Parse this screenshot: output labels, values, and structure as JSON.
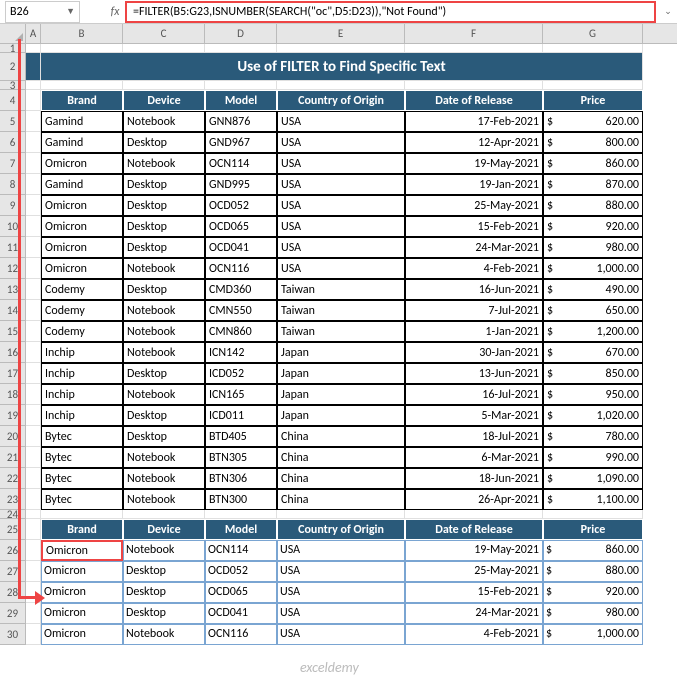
{
  "nameBox": "B26",
  "formula": "=FILTER(B5:G23,ISNUMBER(SEARCH(\"oc\",D5:D23)),\"Not Found\")",
  "columns": [
    "A",
    "B",
    "C",
    "D",
    "E",
    "F",
    "G"
  ],
  "title": "Use of FILTER to Find Specific Text",
  "headers": {
    "brand": "Brand",
    "device": "Device",
    "model": "Model",
    "country": "Country of Origin",
    "date": "Date of Release",
    "price": "Price"
  },
  "currency": "$",
  "rows": [
    {
      "r": 5,
      "brand": "Gamind",
      "device": "Notebook",
      "model": "GNN876",
      "country": "USA",
      "date": "17-Feb-2021",
      "price": "620.00"
    },
    {
      "r": 6,
      "brand": "Gamind",
      "device": "Desktop",
      "model": "GND967",
      "country": "USA",
      "date": "12-Apr-2021",
      "price": "800.00"
    },
    {
      "r": 7,
      "brand": "Omicron",
      "device": "Notebook",
      "model": "OCN114",
      "country": "USA",
      "date": "19-May-2021",
      "price": "860.00"
    },
    {
      "r": 8,
      "brand": "Gamind",
      "device": "Desktop",
      "model": "GND995",
      "country": "USA",
      "date": "19-Jan-2021",
      "price": "870.00"
    },
    {
      "r": 9,
      "brand": "Omicron",
      "device": "Desktop",
      "model": "OCD052",
      "country": "USA",
      "date": "25-May-2021",
      "price": "880.00"
    },
    {
      "r": 10,
      "brand": "Omicron",
      "device": "Desktop",
      "model": "OCD065",
      "country": "USA",
      "date": "15-Feb-2021",
      "price": "920.00"
    },
    {
      "r": 11,
      "brand": "Omicron",
      "device": "Desktop",
      "model": "OCD041",
      "country": "USA",
      "date": "24-Mar-2021",
      "price": "980.00"
    },
    {
      "r": 12,
      "brand": "Omicron",
      "device": "Notebook",
      "model": "OCN116",
      "country": "USA",
      "date": "4-Feb-2021",
      "price": "1,000.00"
    },
    {
      "r": 13,
      "brand": "Codemy",
      "device": "Desktop",
      "model": "CMD360",
      "country": "Taiwan",
      "date": "16-Jun-2021",
      "price": "490.00"
    },
    {
      "r": 14,
      "brand": "Codemy",
      "device": "Notebook",
      "model": "CMN550",
      "country": "Taiwan",
      "date": "7-Jul-2021",
      "price": "650.00"
    },
    {
      "r": 15,
      "brand": "Codemy",
      "device": "Notebook",
      "model": "CMN860",
      "country": "Taiwan",
      "date": "1-Jan-2021",
      "price": "1,200.00"
    },
    {
      "r": 16,
      "brand": "Inchip",
      "device": "Notebook",
      "model": "ICN142",
      "country": "Japan",
      "date": "30-Jan-2021",
      "price": "670.00"
    },
    {
      "r": 17,
      "brand": "Inchip",
      "device": "Desktop",
      "model": "ICD052",
      "country": "Japan",
      "date": "13-Jun-2021",
      "price": "850.00"
    },
    {
      "r": 18,
      "brand": "Inchip",
      "device": "Notebook",
      "model": "ICN165",
      "country": "Japan",
      "date": "16-Jul-2021",
      "price": "950.00"
    },
    {
      "r": 19,
      "brand": "Inchip",
      "device": "Desktop",
      "model": "ICD011",
      "country": "Japan",
      "date": "5-Mar-2021",
      "price": "1,020.00"
    },
    {
      "r": 20,
      "brand": "Bytec",
      "device": "Desktop",
      "model": "BTD405",
      "country": "China",
      "date": "18-Jul-2021",
      "price": "780.00"
    },
    {
      "r": 21,
      "brand": "Bytec",
      "device": "Notebook",
      "model": "BTN305",
      "country": "China",
      "date": "6-Mar-2021",
      "price": "990.00"
    },
    {
      "r": 22,
      "brand": "Bytec",
      "device": "Notebook",
      "model": "BTN306",
      "country": "China",
      "date": "18-Jun-2021",
      "price": "1,090.00"
    },
    {
      "r": 23,
      "brand": "Bytec",
      "device": "Notebook",
      "model": "BTN300",
      "country": "China",
      "date": "26-Apr-2021",
      "price": "1,100.00"
    }
  ],
  "results": [
    {
      "r": 26,
      "brand": "Omicron",
      "device": "Notebook",
      "model": "OCN114",
      "country": "USA",
      "date": "19-May-2021",
      "price": "860.00"
    },
    {
      "r": 27,
      "brand": "Omicron",
      "device": "Desktop",
      "model": "OCD052",
      "country": "USA",
      "date": "25-May-2021",
      "price": "880.00"
    },
    {
      "r": 28,
      "brand": "Omicron",
      "device": "Desktop",
      "model": "OCD065",
      "country": "USA",
      "date": "15-Feb-2021",
      "price": "920.00"
    },
    {
      "r": 29,
      "brand": "Omicron",
      "device": "Desktop",
      "model": "OCD041",
      "country": "USA",
      "date": "24-Mar-2021",
      "price": "980.00"
    },
    {
      "r": 30,
      "brand": "Omicron",
      "device": "Notebook",
      "model": "OCN116",
      "country": "USA",
      "date": "4-Feb-2021",
      "price": "1,000.00"
    }
  ],
  "watermark": "exceldemy"
}
